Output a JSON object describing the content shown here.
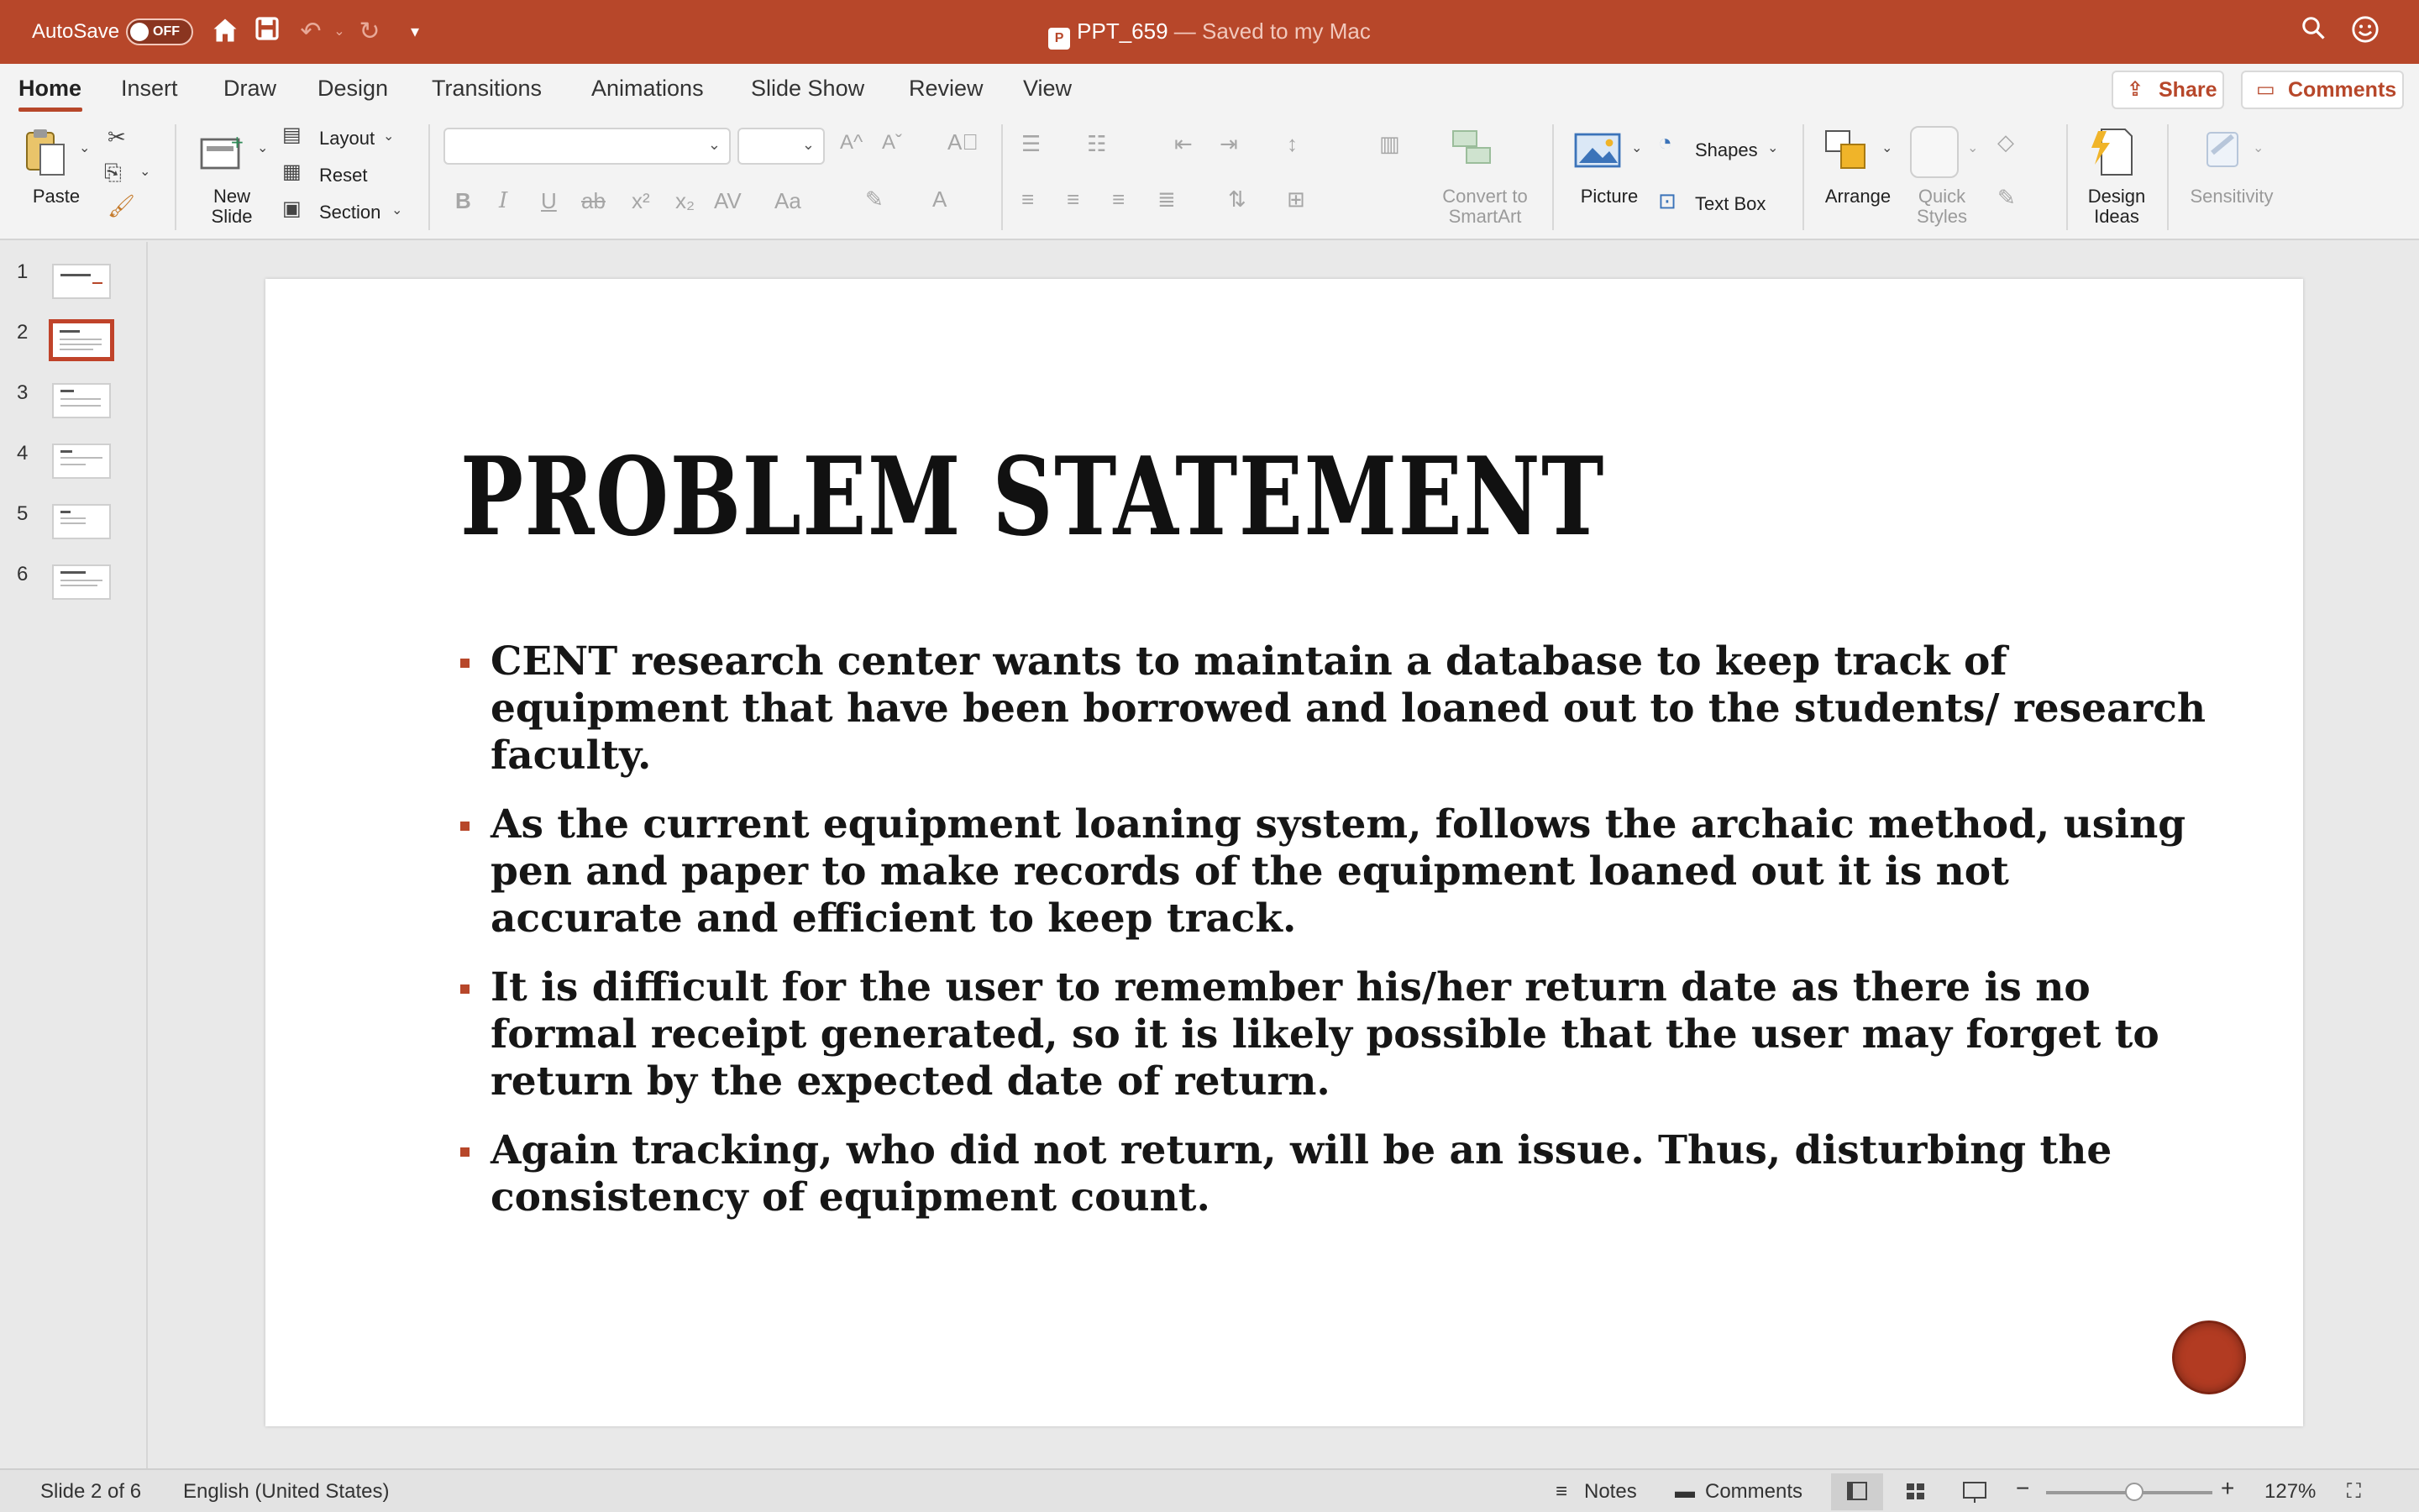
{
  "titlebar": {
    "autosave_label": "AutoSave",
    "autosave_state": "OFF",
    "doc_name": "PPT_659",
    "save_status": "— Saved to my Mac",
    "accent_color": "#b7472a"
  },
  "tabs": {
    "items": [
      "Home",
      "Insert",
      "Draw",
      "Design",
      "Transitions",
      "Animations",
      "Slide Show",
      "Review",
      "View"
    ],
    "active": "Home",
    "share_label": "Share",
    "comments_label": "Comments"
  },
  "ribbon": {
    "paste": "Paste",
    "new_slide_1": "New",
    "new_slide_2": "Slide",
    "layout": "Layout",
    "reset": "Reset",
    "section": "Section",
    "convert_1": "Convert to",
    "convert_2": "SmartArt",
    "picture": "Picture",
    "shapes": "Shapes",
    "text_box": "Text Box",
    "arrange": "Arrange",
    "quick_styles_1": "Quick",
    "quick_styles_2": "Styles",
    "design_ideas_1": "Design",
    "design_ideas_2": "Ideas",
    "sensitivity": "Sensitivity",
    "font_buttons": [
      "B",
      "I",
      "U",
      "ab",
      "x²",
      "x₂",
      "AV",
      "Aa"
    ],
    "grow_font": "A^",
    "shrink_font": "Aˇ"
  },
  "thumbnails": {
    "numbers": [
      "1",
      "2",
      "3",
      "4",
      "5",
      "6"
    ],
    "selected_index": 2
  },
  "slide": {
    "title": "PROBLEM STATEMENT",
    "bullets": [
      "CENT research center wants to maintain a database to keep track of equipment that have been borrowed and loaned out to the students/ research faculty.",
      "As the current equipment loaning system, follows the archaic method, using pen and paper to make records of the equipment loaned out it is not accurate and efficient to keep track.",
      "It is difficult for the user to remember his/her return date as there is no formal receipt generated, so it is likely possible that the user may forget to return by the expected date of return.",
      "Again tracking, who did not return, will be an issue. Thus, disturbing the consistency of equipment count."
    ]
  },
  "statusbar": {
    "slide_info": "Slide 2 of 6",
    "language": "English (United States)",
    "notes": "Notes",
    "comments": "Comments",
    "zoom": "127%"
  }
}
